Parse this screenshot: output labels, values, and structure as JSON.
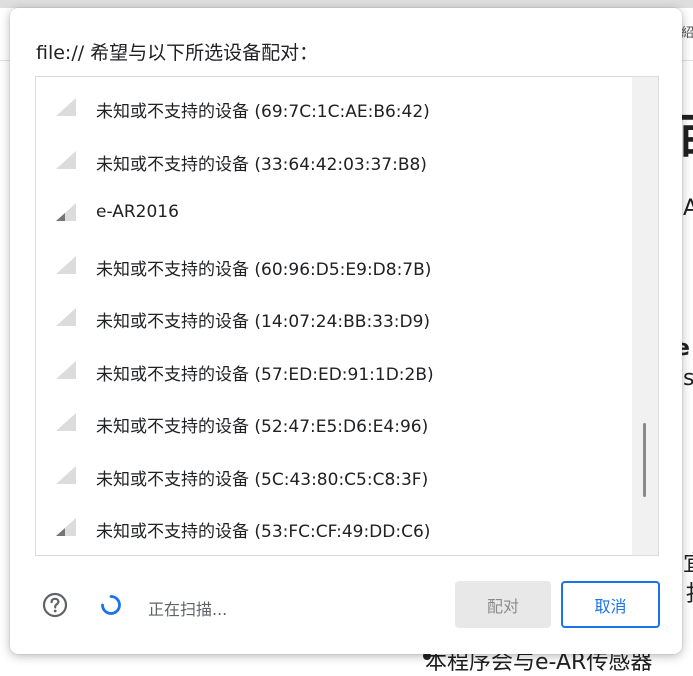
{
  "dialog": {
    "title": "file:// 希望与以下所选设备配对：",
    "devices": [
      {
        "name": "未知或不支持的设备 (69:7C:1C:AE:B6:42)",
        "signal": 1
      },
      {
        "name": "未知或不支持的设备 (33:64:42:03:37:B8)",
        "signal": 1
      },
      {
        "name": "e-AR2016",
        "signal": 2
      },
      {
        "name": "未知或不支持的设备 (60:96:D5:E9:D8:7B)",
        "signal": 1
      },
      {
        "name": "未知或不支持的设备 (14:07:24:BB:33:D9)",
        "signal": 1
      },
      {
        "name": "未知或不支持的设备 (57:ED:ED:91:1D:2B)",
        "signal": 1
      },
      {
        "name": "未知或不支持的设备 (52:47:E5:D6:E4:96)",
        "signal": 1
      },
      {
        "name": "未知或不支持的设备 (5C:43:80:C5:C8:3F)",
        "signal": 1
      },
      {
        "name": "未知或不支持的设备 (53:FC:CF:49:DD:C6)",
        "signal": 2
      }
    ],
    "status": "正在扫描...",
    "pair_label": "配对",
    "cancel_label": "取消"
  },
  "background": {
    "frag1": "紹",
    "frag2": "百",
    "frag3": "A",
    "frag4": "e",
    "frag5": "s",
    "frag6": "宜",
    "frag7": "扌",
    "bottom_text": "本程序会与e-AR传感器"
  },
  "colors": {
    "accent": "#1a73e8",
    "signal_dark": "#757575",
    "signal_light": "#dcdcdc"
  },
  "icons": {
    "help": "help-circle-icon",
    "spinner": "loading-spinner-icon",
    "signal": "signal-strength-icon"
  }
}
